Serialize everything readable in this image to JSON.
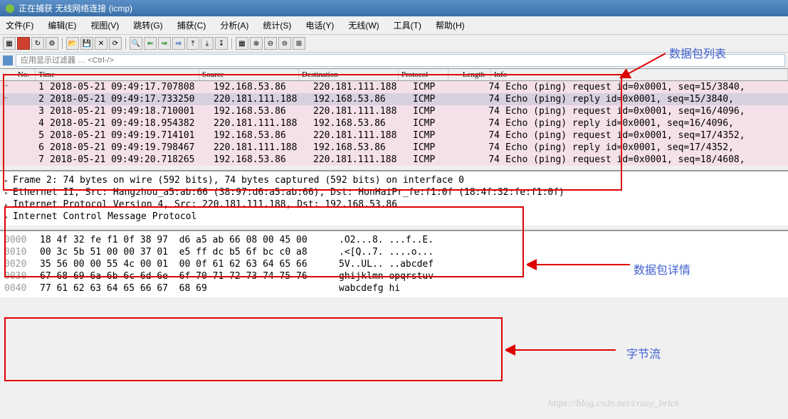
{
  "title": "正在捕获 无线网络连接 (icmp)",
  "menus": [
    "文件(F)",
    "编辑(E)",
    "视图(V)",
    "跳转(G)",
    "捕获(C)",
    "分析(A)",
    "统计(S)",
    "电话(Y)",
    "无线(W)",
    "工具(T)",
    "帮助(H)"
  ],
  "filter_placeholder": "应用显示过滤器 … <Ctrl-/>",
  "columns": {
    "no": "No.",
    "time": "Time",
    "src": "Source",
    "dst": "Destination",
    "proto": "Protocol",
    "len": "Length",
    "info": "Info"
  },
  "packets": [
    {
      "no": "1",
      "time": "2018-05-21 09:49:17.707808",
      "src": "192.168.53.86",
      "dst": "220.181.111.188",
      "proto": "ICMP",
      "len": "74",
      "info": "Echo (ping) request  id=0x0001, seq=15/3840,",
      "sel": false,
      "arrow": "→"
    },
    {
      "no": "2",
      "time": "2018-05-21 09:49:17.733250",
      "src": "220.181.111.188",
      "dst": "192.168.53.86",
      "proto": "ICMP",
      "len": "74",
      "info": "Echo (ping) reply    id=0x0001, seq=15/3840,",
      "sel": true,
      "arrow": "←"
    },
    {
      "no": "3",
      "time": "2018-05-21 09:49:18.710001",
      "src": "192.168.53.86",
      "dst": "220.181.111.188",
      "proto": "ICMP",
      "len": "74",
      "info": "Echo (ping) request  id=0x0001, seq=16/4096,",
      "sel": false,
      "arrow": ""
    },
    {
      "no": "4",
      "time": "2018-05-21 09:49:18.954382",
      "src": "220.181.111.188",
      "dst": "192.168.53.86",
      "proto": "ICMP",
      "len": "74",
      "info": "Echo (ping) reply    id=0x0001, seq=16/4096,",
      "sel": false,
      "arrow": ""
    },
    {
      "no": "5",
      "time": "2018-05-21 09:49:19.714101",
      "src": "192.168.53.86",
      "dst": "220.181.111.188",
      "proto": "ICMP",
      "len": "74",
      "info": "Echo (ping) request  id=0x0001, seq=17/4352,",
      "sel": false,
      "arrow": ""
    },
    {
      "no": "6",
      "time": "2018-05-21 09:49:19.798467",
      "src": "220.181.111.188",
      "dst": "192.168.53.86",
      "proto": "ICMP",
      "len": "74",
      "info": "Echo (ping) reply    id=0x0001, seq=17/4352,",
      "sel": false,
      "arrow": ""
    },
    {
      "no": "7",
      "time": "2018-05-21 09:49:20.718265",
      "src": "192.168.53.86",
      "dst": "220.181.111.188",
      "proto": "ICMP",
      "len": "74",
      "info": "Echo (ping) request  id=0x0001, seq=18/4608,",
      "sel": false,
      "arrow": ""
    }
  ],
  "details": [
    "Frame 2: 74 bytes on wire (592 bits), 74 bytes captured (592 bits) on interface 0",
    "Ethernet II, Src: Hangzhou_a5:ab:66 (38:97:d6:a5:ab:66), Dst: HonHaiPr_fe:f1:0f (18:4f:32:fe:f1:0f)",
    "Internet Protocol Version 4, Src: 220.181.111.188, Dst: 192.168.53.86",
    "Internet Control Message Protocol"
  ],
  "hex": [
    {
      "off": "0000",
      "b": "18 4f 32 fe f1 0f 38 97  d6 a5 ab 66 08 00 45 00",
      "a": ".O2...8. ...f..E."
    },
    {
      "off": "0010",
      "b": "00 3c 5b 51 00 00 37 01  e5 ff dc b5 6f bc c0 a8",
      "a": ".<[Q..7. ....o..."
    },
    {
      "off": "0020",
      "b": "35 56 00 00 55 4c 00 01  00 0f 61 62 63 64 65 66",
      "a": "5V..UL.. ..abcdef"
    },
    {
      "off": "0030",
      "b": "67 68 69 6a 6b 6c 6d 6e  6f 70 71 72 73 74 75 76",
      "a": "ghijklmn opqrstuv"
    },
    {
      "off": "0040",
      "b": "77 61 62 63 64 65 66 67  68 69",
      "a": "wabcdefg hi"
    }
  ],
  "annotations": {
    "list": "数据包列表",
    "detail": "数据包详情",
    "bytes": "字节流"
  },
  "watermark": "https://blog.csdn.net/crazy_brick"
}
